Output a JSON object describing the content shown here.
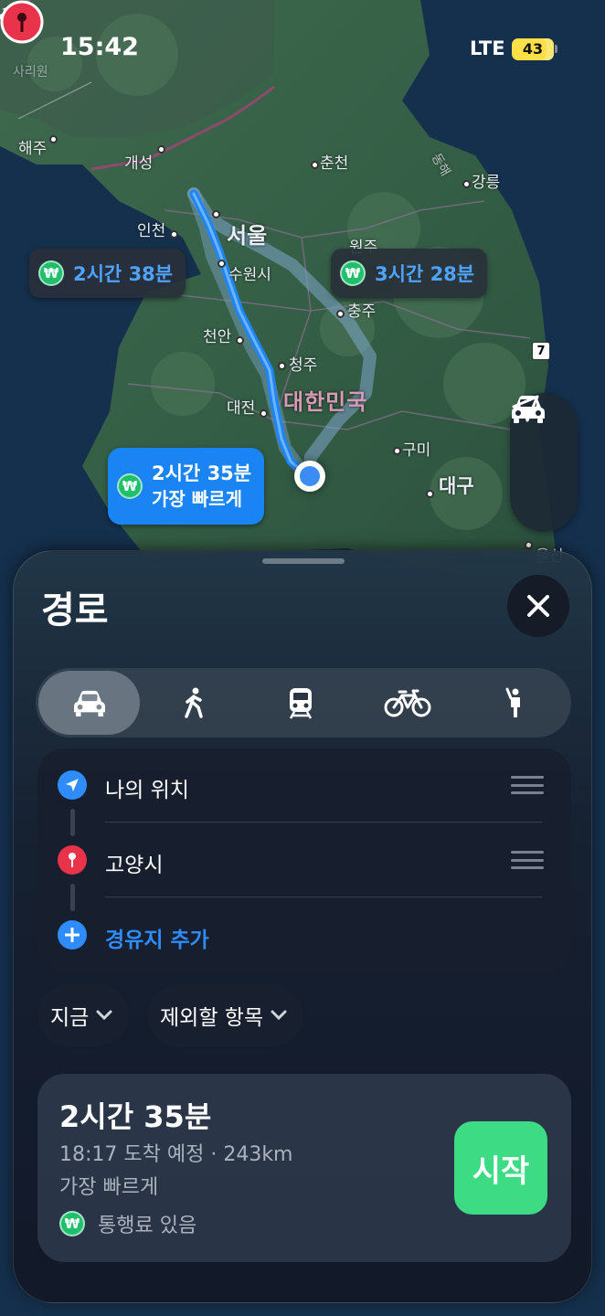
{
  "status_bar": {
    "time": "15:42",
    "network": "LTE",
    "battery": "43"
  },
  "map": {
    "cities": [
      {
        "name": "해주"
      },
      {
        "name": "개성"
      },
      {
        "name": "춘천"
      },
      {
        "name": "강릉"
      },
      {
        "name": "인천"
      },
      {
        "name": "서울"
      },
      {
        "name": "원주"
      },
      {
        "name": "수원시"
      },
      {
        "name": "충주"
      },
      {
        "name": "천안"
      },
      {
        "name": "청주"
      },
      {
        "name": "대전"
      },
      {
        "name": "구미"
      },
      {
        "name": "대구"
      },
      {
        "name": "울산"
      },
      {
        "name": "사리원"
      }
    ],
    "country_label": "대한민국",
    "route_sign": "7",
    "sea_label": "동해"
  },
  "route_bubbles": {
    "alt1": "2시간 38분",
    "alt2": "3시간 28분",
    "primary_time": "2시간 35분",
    "primary_sub": "가장 빠르게",
    "won_symbol": "₩"
  },
  "sheet": {
    "title": "경로",
    "waypoints": {
      "origin": "나의 위치",
      "destination": "고양시",
      "add_stop": "경유지 추가"
    },
    "options": {
      "depart": "지금",
      "avoid": "제외할 항목"
    },
    "route": {
      "time": "2시간 35분",
      "eta": "18:17 도착 예정 · 243km",
      "desc": "가장 빠르게",
      "toll": "통행료 있음",
      "start": "시작"
    }
  },
  "colors": {
    "accent": "#1a84f5",
    "start": "#3ddc84",
    "toll": "#1fbf6b",
    "pin": "#e8334a"
  }
}
